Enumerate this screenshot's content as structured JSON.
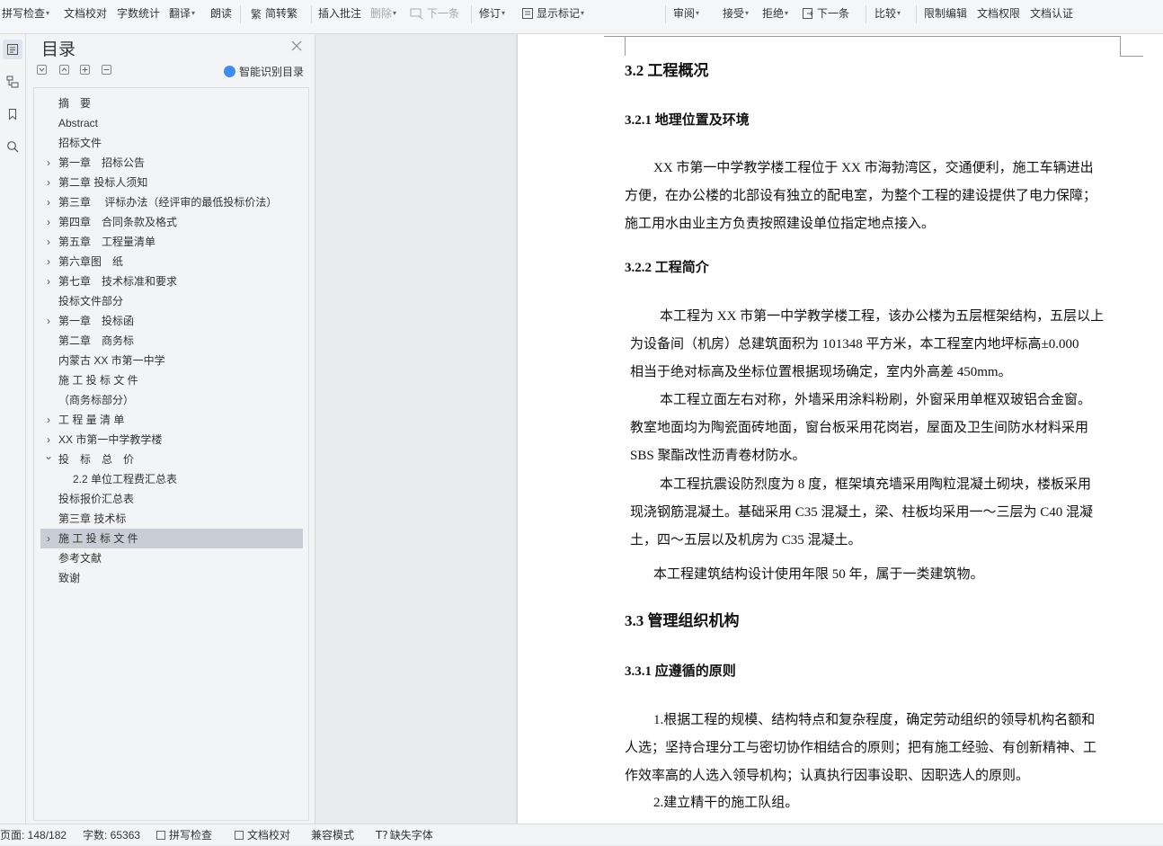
{
  "toolbar": {
    "items": [
      {
        "label": "拼写检查",
        "caret": true,
        "disabled": false
      },
      {
        "label": "文档校对",
        "caret": false,
        "disabled": false
      },
      {
        "label": "字数统计",
        "caret": false,
        "disabled": false
      },
      {
        "label": "翻译",
        "caret": true,
        "disabled": false
      },
      {
        "label": "朗读",
        "caret": false,
        "disabled": false
      },
      {
        "label": "简转繁",
        "caret": false,
        "disabled": false,
        "icon": "traditional-chinese-icon"
      },
      {
        "label": "插入批注",
        "caret": false,
        "disabled": false
      },
      {
        "label": "删除",
        "caret": true,
        "disabled": true
      },
      {
        "label": "下一条",
        "caret": false,
        "disabled": true,
        "icon": "next-comment-icon"
      },
      {
        "label": "修订",
        "caret": true,
        "disabled": false
      },
      {
        "label": "显示标记",
        "caret": true,
        "disabled": false,
        "icon": "show-markup-icon"
      },
      {
        "label": "审阅",
        "caret": true,
        "disabled": false
      },
      {
        "label": "接受",
        "caret": true,
        "disabled": false
      },
      {
        "label": "拒绝",
        "caret": true,
        "disabled": false
      },
      {
        "label": "下一条",
        "caret": false,
        "disabled": false,
        "icon": "next-revision-icon"
      },
      {
        "label": "比较",
        "caret": true,
        "disabled": false
      },
      {
        "label": "限制编辑",
        "caret": false,
        "disabled": false
      },
      {
        "label": "文档权限",
        "caret": false,
        "disabled": false
      },
      {
        "label": "文档认证",
        "caret": false,
        "disabled": false
      }
    ]
  },
  "rail": {
    "icons": [
      "toc-icon",
      "navigation-icon",
      "bookmark-icon",
      "search-icon"
    ]
  },
  "toc": {
    "title": "目录",
    "smart_label": "智能识别目录",
    "items": [
      {
        "label": "摘　要",
        "level": 0,
        "arrow": ""
      },
      {
        "label": "Abstract",
        "level": 0,
        "arrow": ""
      },
      {
        "label": "招标文件",
        "level": 0,
        "arrow": ""
      },
      {
        "label": "第一章　招标公告",
        "level": 0,
        "arrow": "collapsed"
      },
      {
        "label": "第二章  投标人须知",
        "level": 0,
        "arrow": "collapsed"
      },
      {
        "label": "第三章　 评标办法（经评审的最低投标价法）",
        "level": 0,
        "arrow": "collapsed"
      },
      {
        "label": "第四章　合同条款及格式",
        "level": 0,
        "arrow": "collapsed"
      },
      {
        "label": "第五章　工程量清单",
        "level": 0,
        "arrow": "collapsed"
      },
      {
        "label": "第六章图　纸",
        "level": 0,
        "arrow": "collapsed"
      },
      {
        "label": "第七章　技术标准和要求",
        "level": 0,
        "arrow": "collapsed"
      },
      {
        "label": "投标文件部分",
        "level": 0,
        "arrow": ""
      },
      {
        "label": "第一章　投标函",
        "level": 0,
        "arrow": "collapsed"
      },
      {
        "label": "第二章　商务标",
        "level": 0,
        "arrow": ""
      },
      {
        "label": "内蒙古 XX 市第一中学",
        "level": 0,
        "arrow": ""
      },
      {
        "label": "施 工 投 标 文 件",
        "level": 0,
        "arrow": ""
      },
      {
        "label": "（商务标部分）",
        "level": 0,
        "arrow": ""
      },
      {
        "label": "工 程 量 清 单",
        "level": 0,
        "arrow": "collapsed"
      },
      {
        "label": "XX 市第一中学教学楼",
        "level": 0,
        "arrow": "collapsed"
      },
      {
        "label": "投　标　总　价",
        "level": 0,
        "arrow": "expanded"
      },
      {
        "label": "2.2 单位工程费汇总表",
        "level": 1,
        "arrow": ""
      },
      {
        "label": "投标报价汇总表",
        "level": 0,
        "arrow": ""
      },
      {
        "label": "第三章  技术标",
        "level": 0,
        "arrow": ""
      },
      {
        "label": "施 工 投 标 文 件",
        "level": 0,
        "arrow": "collapsed",
        "selected": true
      },
      {
        "label": "参考文献",
        "level": 0,
        "arrow": ""
      },
      {
        "label": "致谢",
        "level": 0,
        "arrow": ""
      }
    ]
  },
  "document": {
    "blocks": [
      {
        "type": "h2",
        "text": "3.2 工程概况"
      },
      {
        "type": "h3",
        "text": "3.2.1  地理位置及环境"
      },
      {
        "type": "p",
        "lines": [
          "XX 市第一中学教学楼工程位于 XX 市海勃湾区，交通便利，施工车辆进出",
          "方便，在办公楼的北部设有独立的配电室，为整个工程的建设提供了电力保障；",
          "施工用水由业主方负责按照建设单位指定地点接入。"
        ]
      },
      {
        "type": "h3",
        "text": "3.2.2  工程简介"
      },
      {
        "type": "p",
        "lines": [
          "本工程为 XX 市第一中学教学楼工程，该办公楼为五层框架结构，五层以上",
          "为设备间（机房）总建筑面积为 101348 平方米，本工程室内地坪标高±0.000",
          "相当于绝对标高及坐标位置根据现场确定，室内外高差 450mm。",
          "本工程立面左右对称，外墙采用涂料粉刷，外窗采用单框双玻铝合金窗。",
          "教室地面均为陶瓷面砖地面，窗台板采用花岗岩，屋面及卫生间防水材料采用",
          "SBS 聚酯改性沥青卷材防水。",
          "本工程抗震设防烈度为 8 度，框架填充墙采用陶粒混凝土砌块，楼板采用",
          "现浇钢筋混凝土。基础采用 C35 混凝土，梁、柱板均采用一～三层为 C40 混凝",
          "土，四～五层以及机房为 C35 混凝土。",
          "本工程建筑结构设计使用年限 50 年，属于一类建筑物。"
        ]
      },
      {
        "type": "h2",
        "text": "3.3 管理组织机构"
      },
      {
        "type": "h3",
        "text": "3.3.1  应遵循的原则"
      },
      {
        "type": "p",
        "lines": [
          "1.根据工程的规模、结构特点和复杂程度，确定劳动组织的领导机构名额和",
          "人选；坚持合理分工与密切协作相结合的原则；把有施工经验、有创新精神、工",
          "作效率高的人选入领导机构；认真执行因事设职、因职选人的原则。",
          "2.建立精干的施工队组。"
        ]
      }
    ]
  },
  "status": {
    "page": "页面: 148/182",
    "word_count": "字数: 65363",
    "spell_check": "拼写检查",
    "proofread": "文档校对",
    "compat_mode": "兼容模式",
    "missing_fonts": "缺失字体"
  }
}
